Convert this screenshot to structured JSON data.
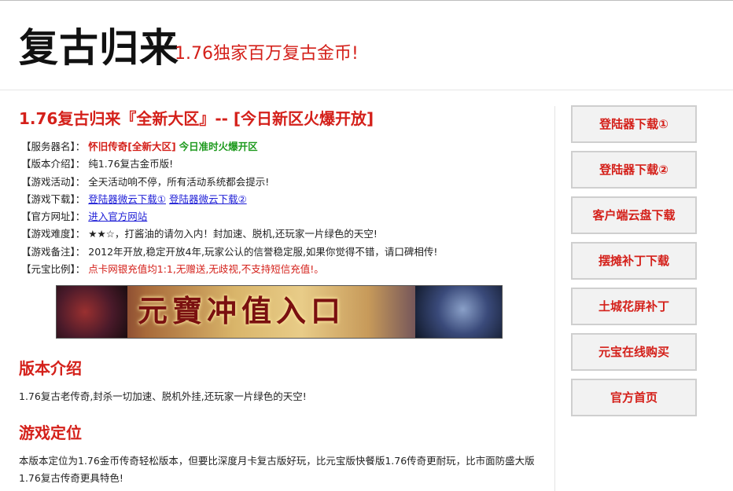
{
  "header": {
    "logo": "复古归来",
    "slogan": "1.76独家百万复古金币!"
  },
  "main": {
    "title": "1.76复古归来『全新大区』-- [今日新区火爆开放]",
    "info": {
      "server_label": "【服务器名】：",
      "server_name": "怀旧传奇[全新大区]",
      "server_status": "今日准时火爆开区",
      "version_label": "【版本介绍】：",
      "version_value": "纯1.76复古金币版!",
      "activity_label": "【游戏活动】：",
      "activity_value": "全天活动响不停，所有活动系统都会提示!",
      "download_label": "【游戏下载】：",
      "download_link1": "登陆器微云下载①",
      "download_link2": "登陆器微云下载②",
      "site_label": "【官方网址】：",
      "site_link": "进入官方网站",
      "difficulty_label": "【游戏难度】：",
      "difficulty_value": "★★☆，打酱油的请勿入内！封加速、脱机,还玩家一片绿色的天空!",
      "note_label": "【游戏备注】：",
      "note_value": "2012年开放,稳定开放4年,玩家公认的信誉稳定服,如果你觉得不错，请口碑相传!",
      "ratio_label": "【元宝比例】：",
      "ratio_value": "点卡网银充值均1:1,无赠送,无歧视,不支持短信充值!。"
    },
    "banner_text": "元寶冲值入口",
    "section1": {
      "heading": "版本介绍",
      "text": "1.76复古老传奇,封杀一切加速、脱机外挂,还玩家一片绿色的天空!"
    },
    "section2": {
      "heading": "游戏定位",
      "text": "本版本定位为1.76金币传奇轻松版本，但要比深度月卡复古版好玩，比元宝版快餐版1.76传奇更耐玩，比市面防盛大版1.76复古传奇更具特色!"
    }
  },
  "sidebar": {
    "buttons": [
      "登陆器下载①",
      "登陆器下载②",
      "客户端云盘下载",
      "摆摊补丁下载",
      "土城花屏补丁",
      "元宝在线购买",
      "官方首页"
    ]
  },
  "colors": {
    "accent_red": "#d4201a",
    "status_green": "#1e9a1e",
    "link_blue": "#1d1dd6"
  }
}
